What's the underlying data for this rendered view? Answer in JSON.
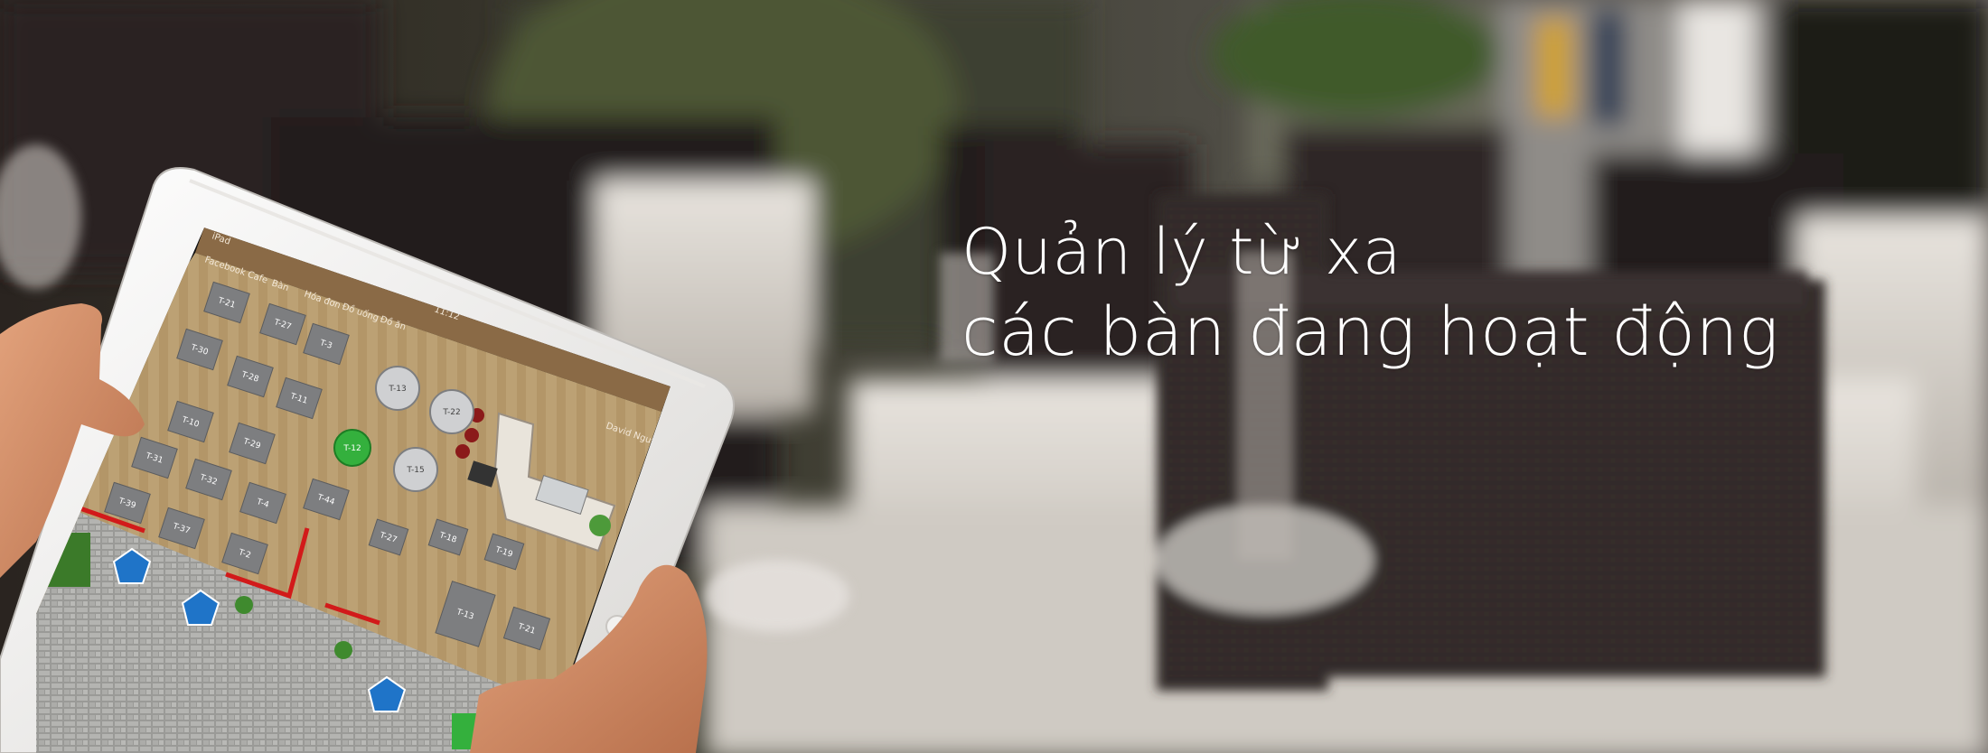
{
  "headline": {
    "line1": "Quản lý từ xa",
    "line2": "các bàn đang hoạt động"
  },
  "tablet_ui": {
    "status_carrier": "iPad",
    "clock": "11:12",
    "app_name": "Facebook Cafe",
    "tabs": [
      {
        "label": "Bàn",
        "active": true
      },
      {
        "label": "Hóa đơn",
        "active": false
      },
      {
        "label": "Đồ uống",
        "active": false
      },
      {
        "label": "Đồ ăn",
        "active": false
      }
    ],
    "user": "David Nguyễn",
    "tables_square": [
      "T-21",
      "T-27",
      "T-3",
      "T-30",
      "T-28",
      "T-11",
      "T-10",
      "T-29",
      "T-31",
      "T-32",
      "T-4",
      "T-44",
      "T-39",
      "T-37",
      "T-2",
      "T-27",
      "T-18",
      "T-19",
      "T-21",
      "T-13"
    ],
    "tables_round": [
      "T-13",
      "T-22",
      "T-15"
    ],
    "table_active": "T-12"
  },
  "colors": {
    "floor": "#b79b6e",
    "header_bar": "#8a6a46",
    "active_table": "#34b03d",
    "wall_red": "#d21a1a",
    "text": "#ffffff"
  }
}
